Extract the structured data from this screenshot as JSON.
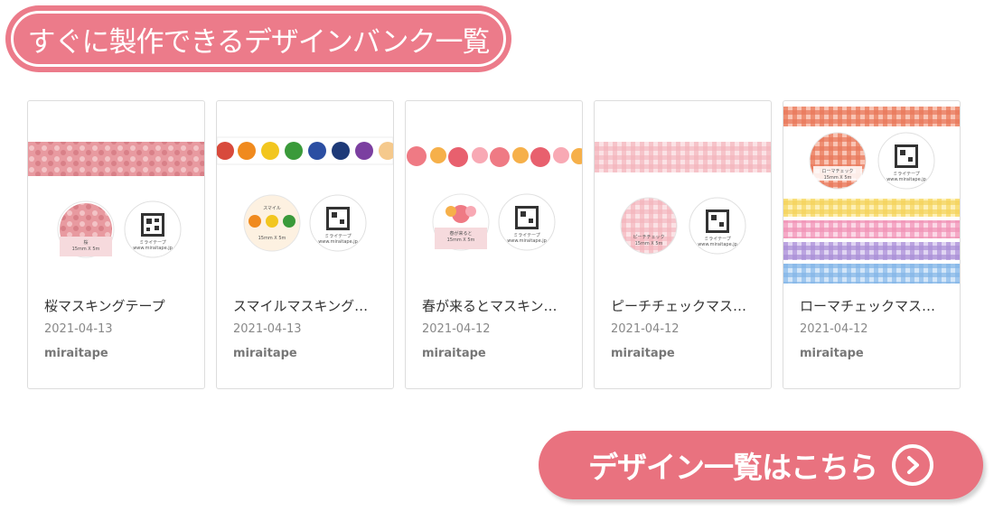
{
  "header": {
    "title": "すぐに製作できるデザインバンク一覧"
  },
  "cards": [
    {
      "title": "桜マスキングテープ",
      "date": "2021-04-13",
      "author": "miraitape"
    },
    {
      "title": "スマイルマスキング…",
      "date": "2021-04-13",
      "author": "miraitape"
    },
    {
      "title": "春が来るとマスキン…",
      "date": "2021-04-12",
      "author": "miraitape"
    },
    {
      "title": "ピーチチェックマス…",
      "date": "2021-04-12",
      "author": "miraitape"
    },
    {
      "title": "ローマチェックマス…",
      "date": "2021-04-12",
      "author": "miraitape"
    }
  ],
  "thumb_text": {
    "smile_label": "スマイル",
    "spring_label": "春が来ると",
    "peach_label": "ピーチチェック",
    "roma_label": "ローマチェック",
    "tape_spec": "15mm X 5m",
    "qr_caption": "ミライテープ",
    "qr_url": "www.miraitape.jp",
    "sakura_label": "桜"
  },
  "cta": {
    "label": "デザイン一覧はこちら",
    "icon": "chevron-right-circle-icon"
  },
  "colors": {
    "accent": "#e9727f",
    "badge": "#ec7b8a"
  }
}
